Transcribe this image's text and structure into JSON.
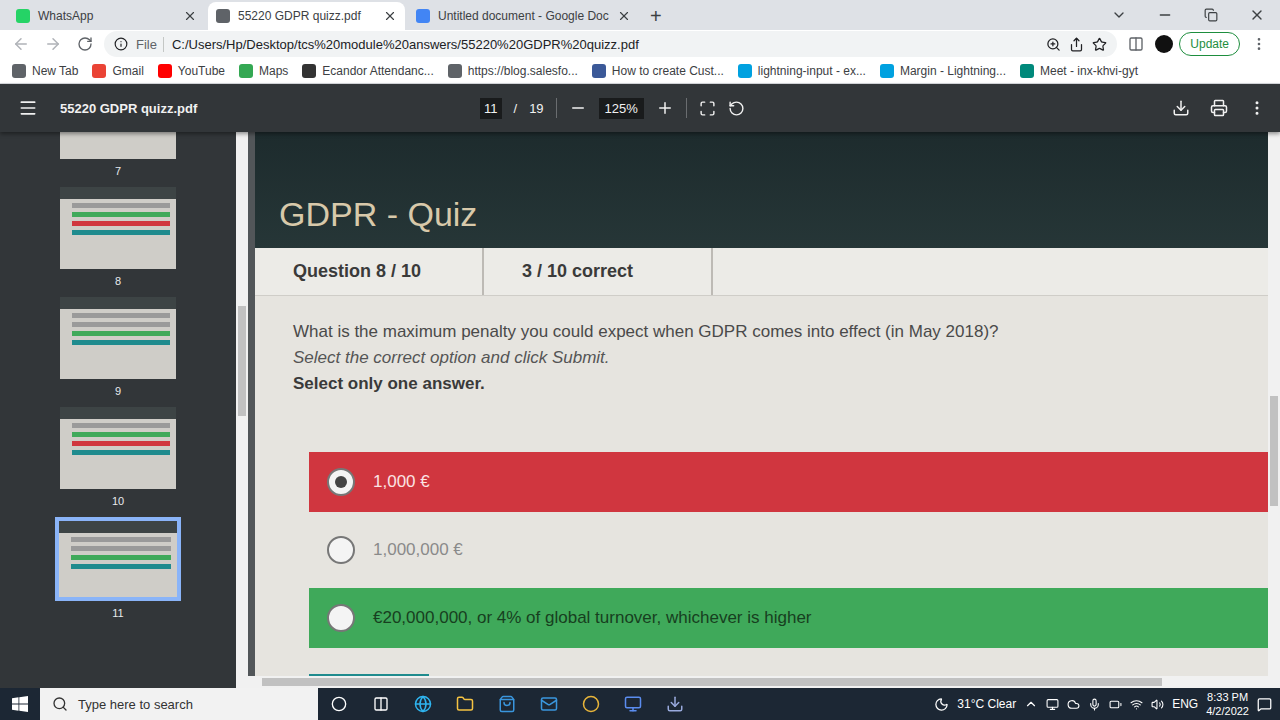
{
  "browser": {
    "tabs": [
      {
        "label": "WhatsApp",
        "selected": false
      },
      {
        "label": "55220 GDPR quizz.pdf",
        "selected": true
      },
      {
        "label": "Untitled document - Google Doc",
        "selected": false
      }
    ],
    "new_tab": "+",
    "address": {
      "scheme": "File",
      "url": "C:/Users/Hp/Desktop/tcs%20module%20answers/55220%20GDPR%20quizz.pdf"
    },
    "update_button": "Update",
    "bookmarks": [
      "New Tab",
      "Gmail",
      "YouTube",
      "Maps",
      "Ecandor Attendanc...",
      "https://blog.salesfo...",
      "How to create Cust...",
      "lightning-input - ex...",
      "Margin - Lightning...",
      "Meet - inx-khvi-gyt"
    ]
  },
  "pdf_viewer": {
    "title": "55220 GDPR quizz.pdf",
    "page": "11",
    "page_separator": "/",
    "page_count": "19",
    "zoom": "125%",
    "thumbnails": [
      {
        "label": "7",
        "selected": false
      },
      {
        "label": "8",
        "selected": false
      },
      {
        "label": "9",
        "selected": false
      },
      {
        "label": "10",
        "selected": false
      },
      {
        "label": "11",
        "selected": true
      }
    ]
  },
  "quiz": {
    "heading": "GDPR - Quiz",
    "tabs": [
      "Question 8 / 10",
      "3 / 10 correct"
    ],
    "question": "What is the maximum penalty you could expect when GDPR comes into effect (in May 2018)?",
    "instruction": "Select the correct option and click Submit.",
    "hint": "Select only one answer.",
    "options": [
      {
        "label": "1,000 €",
        "selected": true,
        "state": "incorrect"
      },
      {
        "label": "1,000,000 €",
        "selected": false,
        "state": "neutral"
      },
      {
        "label": "€20,000,000, or 4% of global turnover, whichever is higher",
        "selected": false,
        "state": "correct"
      }
    ]
  },
  "taskbar": {
    "search_placeholder": "Type here to search",
    "weather": "31°C Clear",
    "language": "ENG",
    "time": "8:33 PM",
    "date": "4/2/2022"
  }
}
